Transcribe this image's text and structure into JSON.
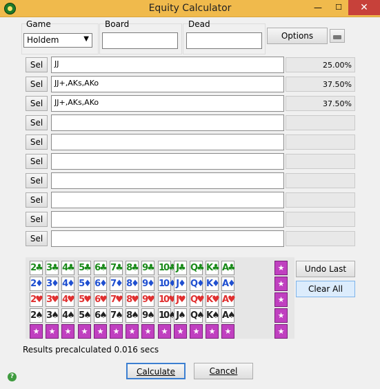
{
  "window": {
    "title": "Equity Calculator",
    "minimize": "—",
    "maximize": "☐",
    "close": "✕"
  },
  "game": {
    "label": "Game",
    "value": "Holdem"
  },
  "board": {
    "label": "Board",
    "value": ""
  },
  "dead": {
    "label": "Dead",
    "value": ""
  },
  "options_label": "Options",
  "players": [
    {
      "sel": "Sel",
      "range": "JJ",
      "equity": "25.00%"
    },
    {
      "sel": "Sel",
      "range": "JJ+,AKs,AKo",
      "equity": "37.50%"
    },
    {
      "sel": "Sel",
      "range": "JJ+,AKs,AKo",
      "equity": "37.50%"
    },
    {
      "sel": "Sel",
      "range": "",
      "equity": ""
    },
    {
      "sel": "Sel",
      "range": "",
      "equity": ""
    },
    {
      "sel": "Sel",
      "range": "",
      "equity": ""
    },
    {
      "sel": "Sel",
      "range": "",
      "equity": ""
    },
    {
      "sel": "Sel",
      "range": "",
      "equity": ""
    },
    {
      "sel": "Sel",
      "range": "",
      "equity": ""
    },
    {
      "sel": "Sel",
      "range": "",
      "equity": ""
    }
  ],
  "deck": {
    "ranks": [
      "2",
      "3",
      "4",
      "5",
      "6",
      "7",
      "8",
      "9",
      "10",
      "J",
      "Q",
      "K",
      "A"
    ],
    "suits": [
      {
        "name": "clubs",
        "symbol": "♣",
        "color": "#1a8a1a"
      },
      {
        "name": "diamonds",
        "symbol": "♦",
        "color": "#1f4fd0"
      },
      {
        "name": "hearts",
        "symbol": "♥",
        "color": "#e03030"
      },
      {
        "name": "spades",
        "symbol": "♠",
        "color": "#222222"
      }
    ],
    "random_symbol": "★"
  },
  "undo_label": "Undo Last",
  "clear_label": "Clear All",
  "status": "Results precalculated 0.016 secs",
  "calculate_label": "Calculate",
  "cancel_label": "Cancel"
}
